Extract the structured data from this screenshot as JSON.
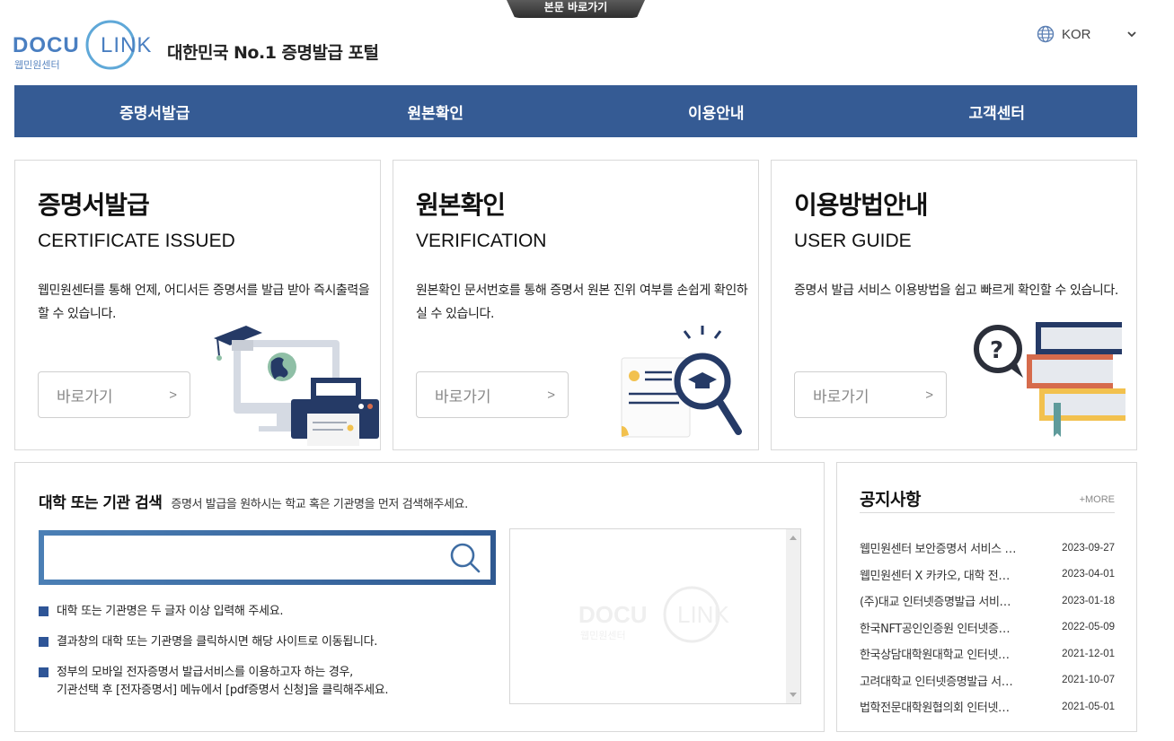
{
  "skip_link": {
    "label": "본문 바로가기"
  },
  "header": {
    "logo": {
      "word_left": "DOCU",
      "word_right": "LINK",
      "sub": "웹민원센터"
    },
    "tagline": "대한민국 No.1 증명발급 포털",
    "language": {
      "selected": "KOR",
      "icon": "globe-icon"
    }
  },
  "nav": {
    "items": [
      {
        "label": "증명서발급"
      },
      {
        "label": "원본확인"
      },
      {
        "label": "이용안내"
      },
      {
        "label": "고객센터"
      }
    ]
  },
  "cards": [
    {
      "title": "증명서발급",
      "subtitle": "CERTIFICATE ISSUED",
      "description": "웹민원센터를 통해 언제, 어디서든 증명서를 발급 받아 즉시출력을 할 수 있습니다.",
      "button_label": "바로가기",
      "button_arrow": ">",
      "illustration": "computer-printer-illustration"
    },
    {
      "title": "원본확인",
      "subtitle": "VERIFICATION",
      "description": "원본확인 문서번호를 통해 증명서 원본 진위 여부를 손쉽게 확인하실 수 있습니다.",
      "button_label": "바로가기",
      "button_arrow": ">",
      "illustration": "certificate-magnifier-illustration"
    },
    {
      "title": "이용방법안내",
      "subtitle": "USER GUIDE",
      "description": "증명서 발급 서비스 이용방법을 쉽고 빠르게 확인할 수 있습니다.",
      "button_label": "바로가기",
      "button_arrow": ">",
      "illustration": "books-question-illustration"
    }
  ],
  "search": {
    "title": "대학 또는 기관 검색",
    "description": "증명서 발급을 원하시는 학교 혹은 기관명을 먼저 검색해주세요.",
    "input_value": "",
    "input_placeholder": "",
    "notes": [
      {
        "text": "대학 또는 기관명은 두 글자 이상 입력해 주세요."
      },
      {
        "text": "결과창의 대학 또는 기관명을 클릭하시면 해당 사이트로 이동됩니다."
      },
      {
        "line1": "정부의 모바일 전자증명서 발급서비스를 이용하고자 하는 경우,",
        "line2": "기관선택 후 [전자증명서] 메뉴에서 [pdf증명서 신청]을 클릭해주세요."
      }
    ],
    "results": []
  },
  "notice": {
    "title": "공지사항",
    "more_label": "+MORE",
    "items": [
      {
        "text": "웹민원센터 보안증명서 서비스 종료 안내",
        "display": "웹민원센터 보안증명서 서비스 …",
        "date": "2023-09-27"
      },
      {
        "text": "웹민원센터 X 카카오, 대학 전…",
        "display": "웹민원센터 X 카카오, 대학 전…",
        "date": "2023-04-01"
      },
      {
        "text": "(주)대교 인터넷증명발급 서비…",
        "display": "(주)대교 인터넷증명발급 서비…",
        "date": "2023-01-18"
      },
      {
        "text": "한국NFT공인인증원 인터넷증…",
        "display": "한국NFT공인인증원 인터넷증…",
        "date": "2022-05-09"
      },
      {
        "text": "한국상담대학원대학교 인터넷…",
        "display": "한국상담대학원대학교 인터넷…",
        "date": "2021-12-01"
      },
      {
        "text": "고려대학교 인터넷증명발급 서…",
        "display": "고려대학교 인터넷증명발급 서…",
        "date": "2021-10-07"
      },
      {
        "text": "법학전문대학원협의회 인터넷…",
        "display": "법학전문대학원협의회 인터넷…",
        "date": "2021-05-01"
      }
    ]
  },
  "colors": {
    "brand_blue": "#355b94",
    "logo_blue": "#4a7fc1",
    "logo_ring": "#5fa8d8",
    "bullet": "#2e5597"
  }
}
